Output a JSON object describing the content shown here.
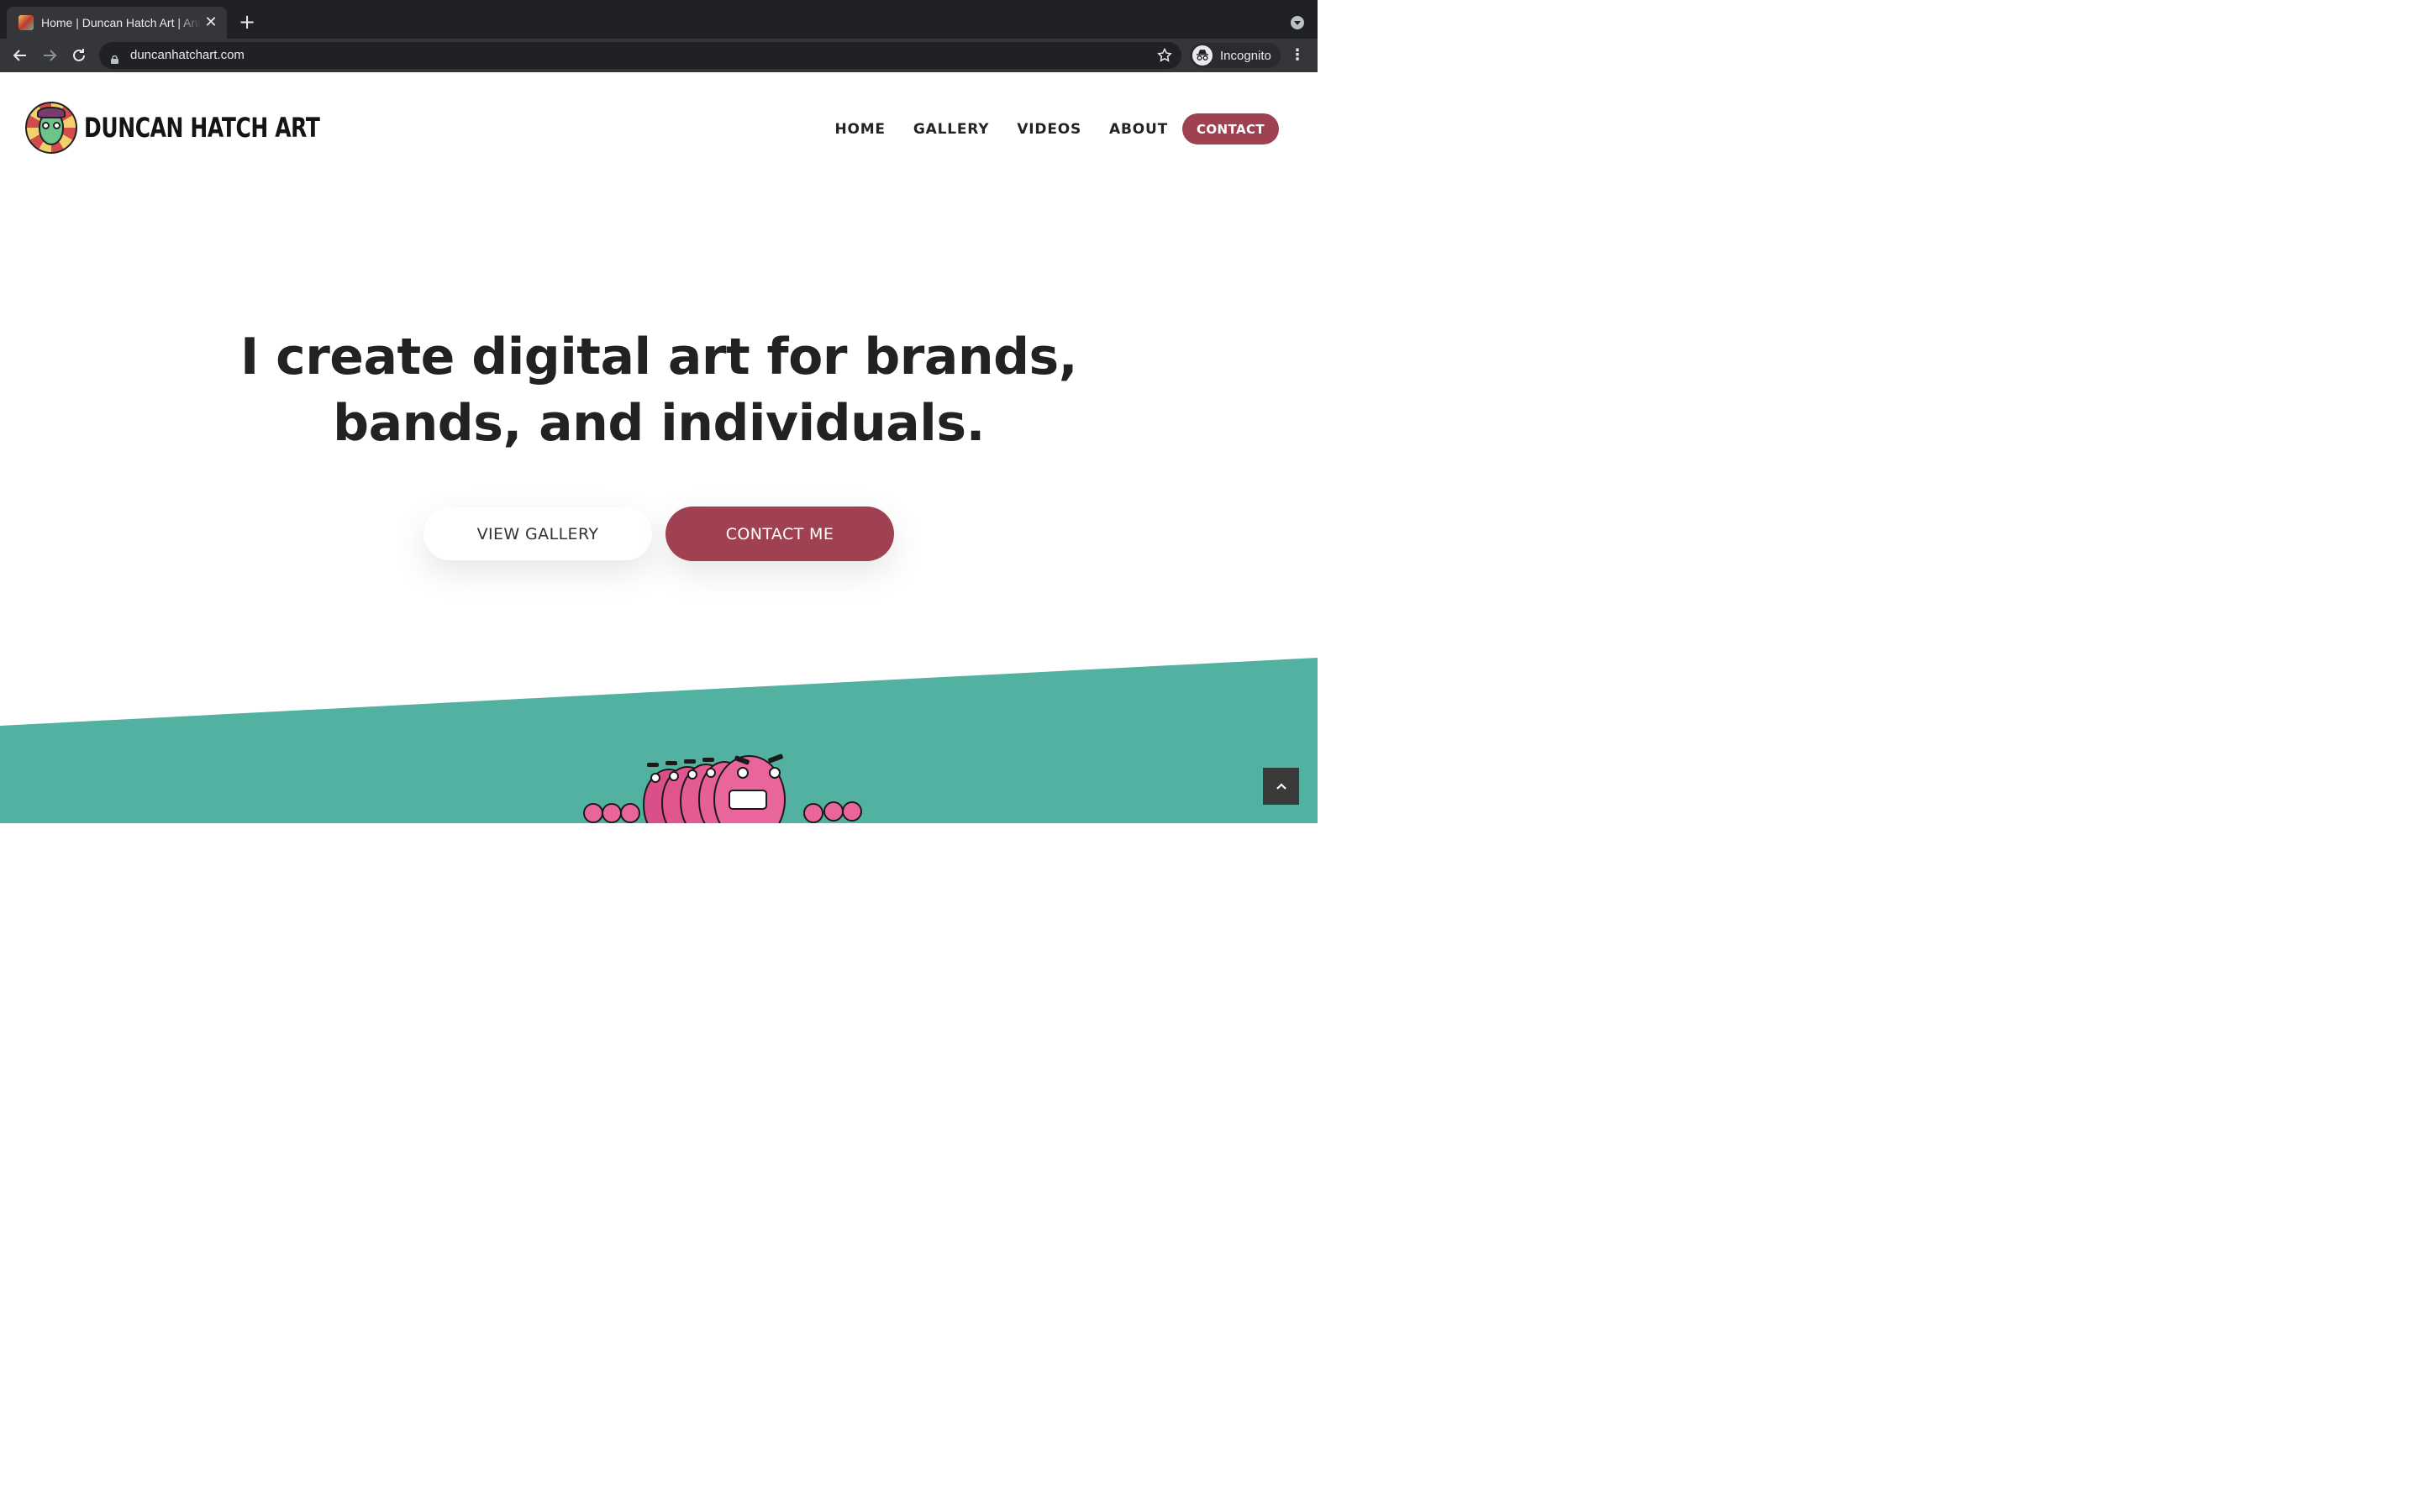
{
  "browser": {
    "tab_title": "Home | Duncan Hatch Art | Animation & Illustration",
    "url": "duncanhatchart.com",
    "profile_label": "Incognito"
  },
  "site": {
    "logo_text": "DUNCAN HATCH ART",
    "nav": [
      {
        "label": "HOME"
      },
      {
        "label": "GALLERY"
      },
      {
        "label": "VIDEOS"
      },
      {
        "label": "ABOUT"
      }
    ],
    "nav_contact_label": "CONTACT"
  },
  "hero": {
    "title_line1": "I create digital art for brands,",
    "title_line2": "bands, and individuals.",
    "view_gallery_label": "VIEW GALLERY",
    "contact_me_label": "CONTACT ME"
  },
  "colors": {
    "accent": "#a04152",
    "teal": "#52b1a0",
    "text": "#222222"
  },
  "icons": {
    "back_to_top": "chevron-up-icon"
  }
}
